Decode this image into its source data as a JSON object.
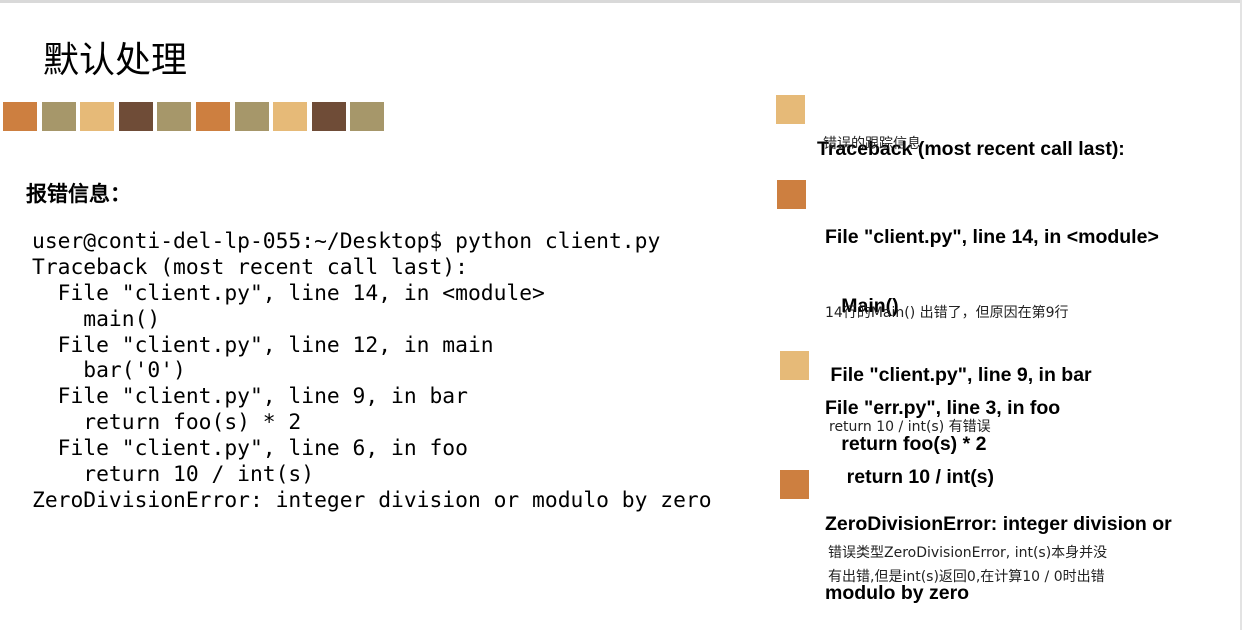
{
  "slide": {
    "title": "默认处理",
    "palette": [
      "#cd7f40",
      "#a6976a",
      "#e6ba78",
      "#6f4c37",
      "#a6976a",
      "#cd7f40",
      "#a6976a",
      "#e6ba78",
      "#6f4c37",
      "#a6976a"
    ],
    "section_heading": "报错信息："
  },
  "terminal": {
    "lines": [
      "user@conti-del-lp-055:~/Desktop$ python client.py",
      "Traceback (most recent call last):",
      "  File \"client.py\", line 14, in <module>",
      "    main()",
      "  File \"client.py\", line 12, in main",
      "    bar('0')",
      "  File \"client.py\", line 9, in bar",
      "    return foo(s) * 2",
      "  File \"client.py\", line 6, in foo",
      "    return 10 / int(s)",
      "ZeroDivisionError: integer division or modulo by zero"
    ]
  },
  "notes": [
    {
      "marker_color": "#e6ba78",
      "heading_lines": [
        "Traceback (most recent call last):"
      ],
      "description_lines": [
        "错误的跟踪信息"
      ]
    },
    {
      "marker_color": "#cd7f40",
      "heading_lines": [
        "File \"client.py\", line 14, in <module>",
        "   Main()",
        " File \"client.py\", line 9, in bar",
        "   return foo(s) * 2"
      ],
      "description_lines": [
        "14行的Main() 出错了，但原因在第9行"
      ]
    },
    {
      "marker_color": "#e6ba78",
      "heading_lines": [
        "File \"err.py\", line 3, in foo",
        "    return 10 / int(s)"
      ],
      "description_lines": [
        "return 10 / int(s) 有错误"
      ]
    },
    {
      "marker_color": "#cd7f40",
      "heading_lines": [
        "ZeroDivisionError: integer division or",
        "modulo by zero"
      ],
      "description_lines": [
        "错误类型ZeroDivisionError, int(s)本身并没",
        "有出错,但是int(s)返回0,在计算10 / 0时出错"
      ]
    }
  ]
}
